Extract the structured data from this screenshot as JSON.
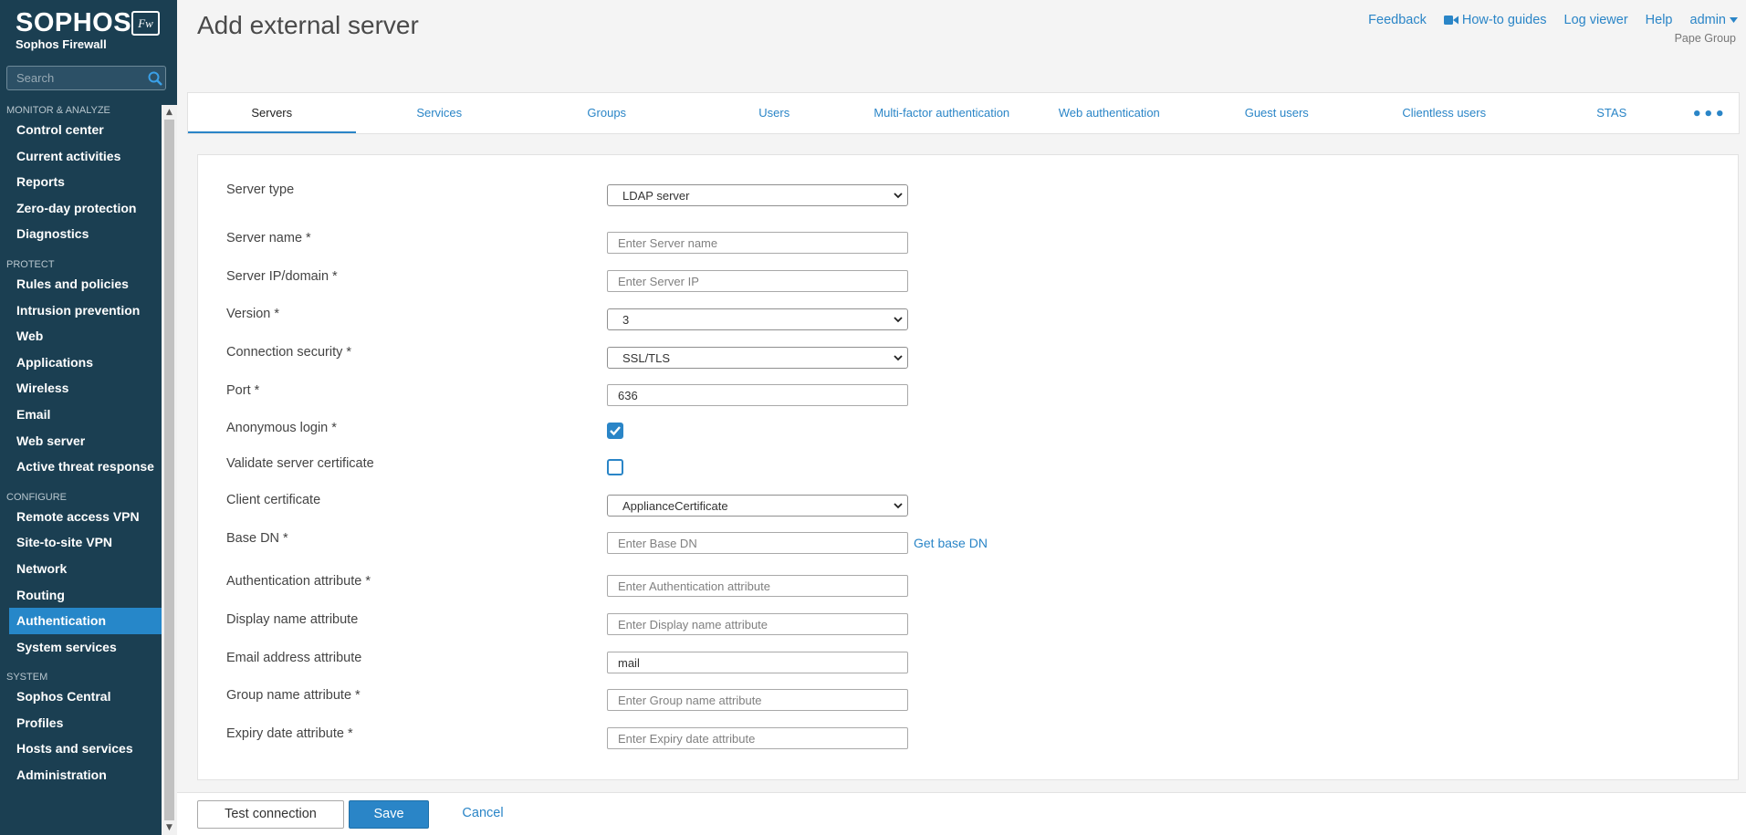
{
  "brand": {
    "logo": "SOPHOS",
    "badge": "Fw",
    "subtitle": "Sophos Firewall"
  },
  "search": {
    "placeholder": "Search"
  },
  "sidebar": {
    "sections": [
      {
        "title": "MONITOR & ANALYZE",
        "items": [
          "Control center",
          "Current activities",
          "Reports",
          "Zero-day protection",
          "Diagnostics"
        ]
      },
      {
        "title": "PROTECT",
        "items": [
          "Rules and policies",
          "Intrusion prevention",
          "Web",
          "Applications",
          "Wireless",
          "Email",
          "Web server",
          "Active threat response"
        ]
      },
      {
        "title": "CONFIGURE",
        "items": [
          "Remote access VPN",
          "Site-to-site VPN",
          "Network",
          "Routing",
          "Authentication",
          "System services"
        ]
      },
      {
        "title": "SYSTEM",
        "items": [
          "Sophos Central",
          "Profiles",
          "Hosts and services",
          "Administration"
        ]
      }
    ],
    "active_item": "Authentication"
  },
  "header": {
    "title": "Add external server",
    "links": {
      "feedback": "Feedback",
      "howto": "How-to guides",
      "log_viewer": "Log viewer",
      "help": "Help",
      "admin": "admin"
    },
    "org": "Pape Group"
  },
  "tabs": [
    "Servers",
    "Services",
    "Groups",
    "Users",
    "Multi-factor authentication",
    "Web authentication",
    "Guest users",
    "Clientless users",
    "STAS"
  ],
  "active_tab": "Servers",
  "form": {
    "server_type": {
      "label": "Server type",
      "value": "LDAP server"
    },
    "server_name": {
      "label": "Server name *",
      "placeholder": "Enter Server name"
    },
    "server_ip": {
      "label": "Server IP/domain *",
      "placeholder": "Enter Server IP"
    },
    "version": {
      "label": "Version *",
      "value": "3"
    },
    "connection_security": {
      "label": "Connection security *",
      "value": "SSL/TLS"
    },
    "port": {
      "label": "Port *",
      "value": "636"
    },
    "anonymous_login": {
      "label": "Anonymous login *",
      "checked": true
    },
    "validate_cert": {
      "label": "Validate server certificate",
      "checked": false
    },
    "client_certificate": {
      "label": "Client certificate",
      "value": "ApplianceCertificate"
    },
    "base_dn": {
      "label": "Base DN *",
      "placeholder": "Enter Base DN",
      "link": "Get base DN"
    },
    "auth_attribute": {
      "label": "Authentication attribute *",
      "placeholder": "Enter Authentication attribute"
    },
    "display_name_attribute": {
      "label": "Display name attribute",
      "placeholder": "Enter Display name attribute"
    },
    "email_attribute": {
      "label": "Email address attribute",
      "value": "mail"
    },
    "group_name_attribute": {
      "label": "Group name attribute *",
      "placeholder": "Enter Group name attribute"
    },
    "expiry_date_attribute": {
      "label": "Expiry date attribute *",
      "placeholder": "Enter Expiry date attribute"
    }
  },
  "footer": {
    "test": "Test connection",
    "save": "Save",
    "cancel": "Cancel"
  },
  "colors": {
    "sidebar_bg": "#1b3f52",
    "accent": "#2a85c7",
    "active_nav": "#2687c9"
  },
  "icons": {
    "search": "search-icon",
    "video": "video-camera-icon",
    "more": "more-dots-icon",
    "dropdown": "chevron-down-icon"
  }
}
